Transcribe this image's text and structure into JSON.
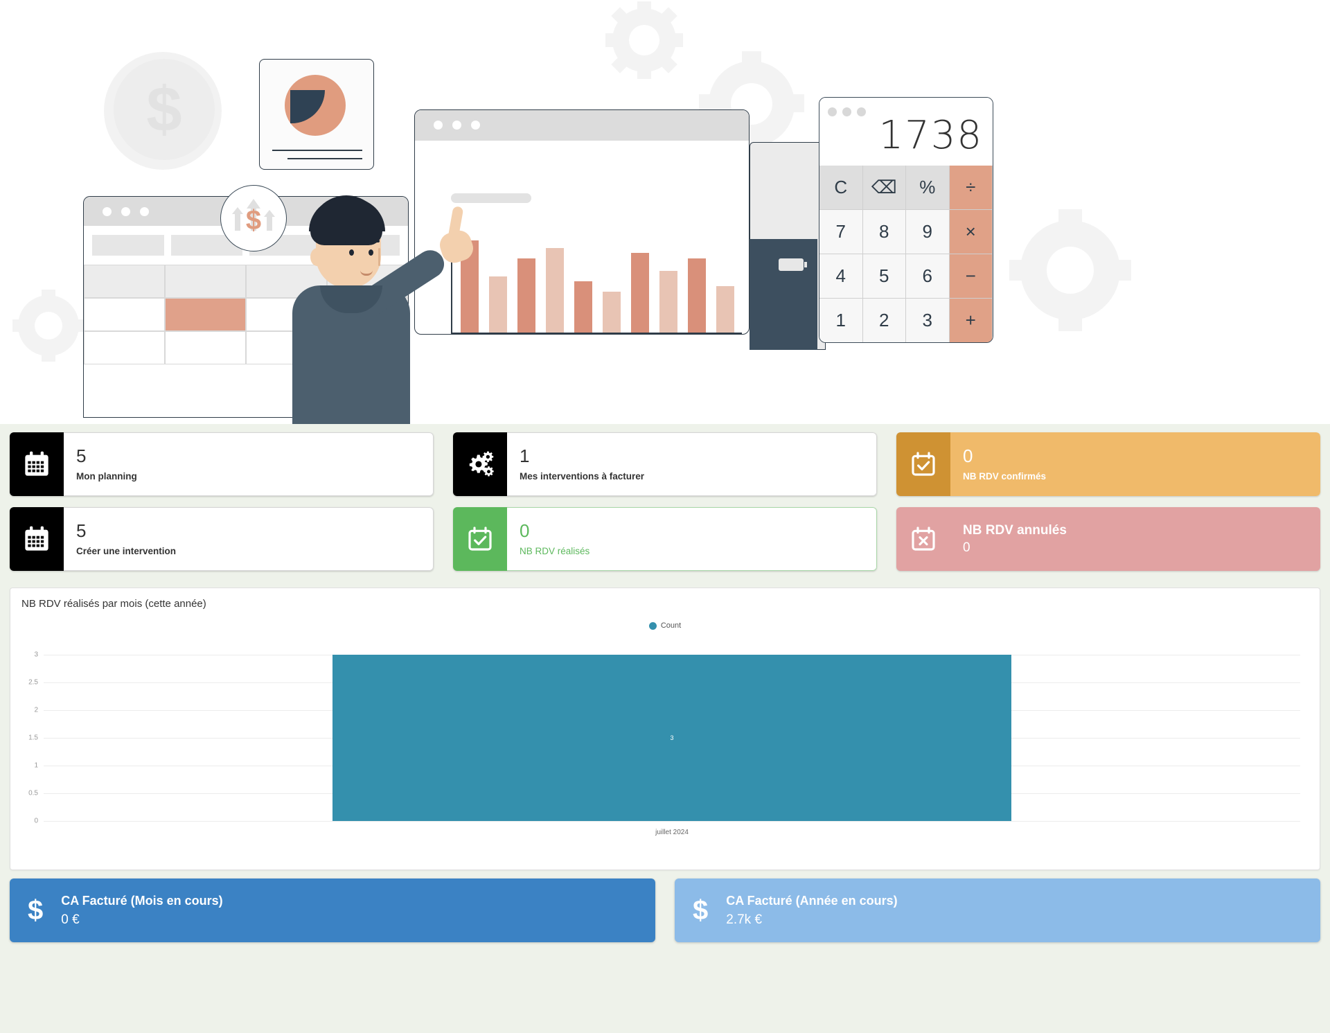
{
  "hero": {
    "calculator": {
      "display": "1738",
      "keys": [
        "C",
        "⌫",
        "%",
        "÷",
        "7",
        "8",
        "9",
        "×",
        "4",
        "5",
        "6",
        "−",
        "1",
        "2",
        "3",
        "+"
      ]
    },
    "illustration_bars": [
      72,
      44,
      58,
      66,
      40,
      32,
      62,
      48,
      58,
      36
    ]
  },
  "kpis": {
    "mon_planning": {
      "value": "5",
      "label": "Mon planning"
    },
    "creer_intervention": {
      "value": "5",
      "label": "Créer une intervention"
    },
    "interventions_facturer": {
      "value": "1",
      "label": "Mes interventions à facturer"
    },
    "rdv_realises": {
      "value": "0",
      "label": "NB RDV réalisés"
    },
    "rdv_confirmes": {
      "value": "0",
      "label": "NB RDV confirmés"
    },
    "rdv_annules": {
      "value": "0",
      "label": "NB RDV annulés"
    }
  },
  "chart_panel": {
    "title": "NB RDV réalisés par mois (cette année)"
  },
  "chart_data": {
    "type": "bar",
    "title": "NB RDV réalisés par mois (cette année)",
    "categories": [
      "juillet 2024"
    ],
    "values": [
      3
    ],
    "series": [
      {
        "name": "Count",
        "values": [
          3
        ]
      }
    ],
    "legend": [
      "Count"
    ],
    "legend_position": "top-center",
    "xlabel": "",
    "ylabel": "",
    "ylim": [
      0,
      3
    ],
    "yticks": [
      "0",
      "0.5",
      "1",
      "1.5",
      "2",
      "2.5",
      "3"
    ],
    "grid": true,
    "bar_color": "#3490ad",
    "data_labels": [
      "3"
    ]
  },
  "ca_cards": {
    "mois": {
      "symbol": "$",
      "title": "CA Facturé (Mois en cours)",
      "value": "0 €"
    },
    "annee": {
      "symbol": "$",
      "title": "CA Facturé (Année en cours)",
      "value": "2.7k €"
    }
  },
  "colors": {
    "background": "#eef2ea",
    "black": "#000000",
    "green": "#5cb85c",
    "orange_icon": "#cf9233",
    "orange_body": "#f0ba6a",
    "pink": "#e1a2a2",
    "chart_blue": "#3490ad",
    "ca_blue_dark": "#3b82c4",
    "ca_blue_light": "#8cbbe8"
  }
}
